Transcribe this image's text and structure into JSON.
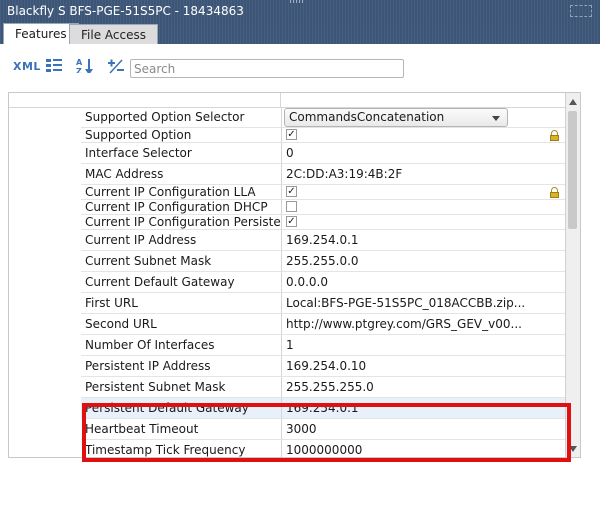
{
  "window": {
    "title": "Blackfly S BFS-PGE-51S5PC - 18434863"
  },
  "tabs": [
    {
      "label": "Features",
      "active": true
    },
    {
      "label": "File Access",
      "active": false
    }
  ],
  "toolbar": {
    "xml_label": "XML",
    "search_placeholder": "Search",
    "icons": [
      "xml-icon",
      "list-view-icon",
      "sort-az-icon",
      "plus-minus-icon"
    ]
  },
  "features": [
    {
      "name": "Supported Option Selector",
      "value": "CommandsConcatenation",
      "type": "dropdown",
      "locked": false
    },
    {
      "name": "Supported Option",
      "value": "✓",
      "type": "checkbox",
      "checked": true,
      "locked": true
    },
    {
      "name": "Interface Selector",
      "value": "0",
      "type": "text",
      "locked": false
    },
    {
      "name": "MAC Address",
      "value": "2C:DD:A3:19:4B:2F",
      "type": "text",
      "locked": true
    },
    {
      "name": "Current IP Configuration LLA",
      "value": "✓",
      "type": "checkbox",
      "checked": true,
      "locked": true
    },
    {
      "name": "Current IP Configuration DHCP",
      "value": "",
      "type": "checkbox",
      "checked": false,
      "locked": false
    },
    {
      "name": "Current IP Configuration Persiste...",
      "value": "✓",
      "type": "checkbox",
      "checked": true,
      "locked": false
    },
    {
      "name": "Current IP Address",
      "value": "169.254.0.1",
      "type": "text",
      "locked": true
    },
    {
      "name": "Current Subnet Mask",
      "value": "255.255.0.0",
      "type": "text",
      "locked": true
    },
    {
      "name": "Current Default Gateway",
      "value": "0.0.0.0",
      "type": "text",
      "locked": true
    },
    {
      "name": "First URL",
      "value": "Local:BFS-PGE-51S5PC_018ACCBB.zip...",
      "type": "text",
      "locked": true
    },
    {
      "name": "Second URL",
      "value": "http://www.ptgrey.com/GRS_GEV_v00...",
      "type": "text",
      "locked": true
    },
    {
      "name": "Number Of Interfaces",
      "value": "1",
      "type": "text",
      "locked": true
    },
    {
      "name": "Persistent IP Address",
      "value": "169.254.0.10",
      "type": "text",
      "locked": false
    },
    {
      "name": "Persistent Subnet Mask",
      "value": "255.255.255.0",
      "type": "text",
      "locked": false
    },
    {
      "name": "Persistent Default Gateway",
      "value": "169.254.0.1",
      "type": "text",
      "locked": false,
      "highlighted": true
    },
    {
      "name": "Heartbeat Timeout",
      "value": "3000",
      "type": "text",
      "locked": false
    },
    {
      "name": "Timestamp Tick Frequency",
      "value": "1000000000",
      "type": "text",
      "locked": true
    }
  ],
  "colors": {
    "titlebar": "#3d5678",
    "highlight_box": "#e01010",
    "lock": "#d8b326",
    "toolbar_icon": "#3a73b8"
  }
}
